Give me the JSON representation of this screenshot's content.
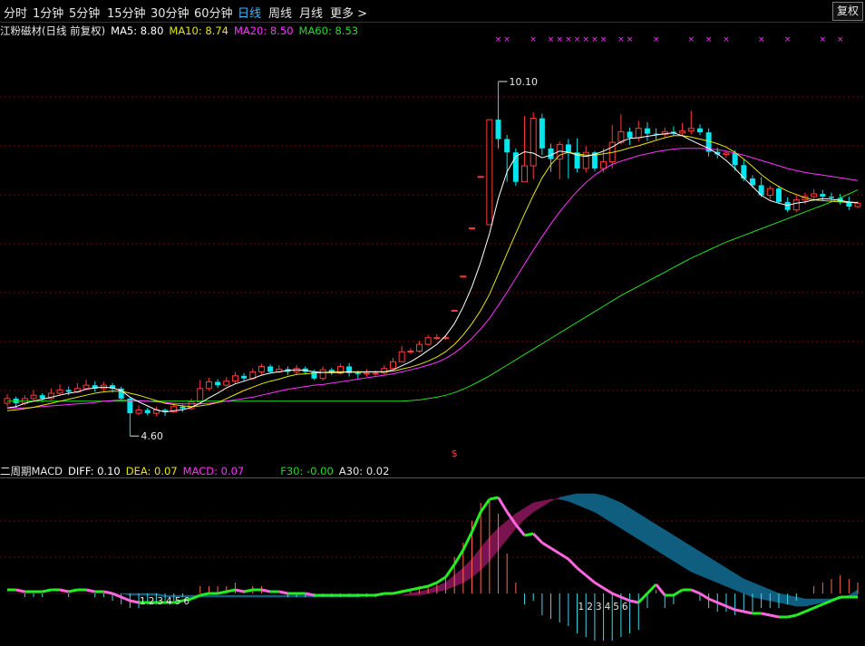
{
  "toolbar": {
    "tabs": [
      "分时",
      "1分钟",
      "5分钟",
      "15分钟",
      "30分钟",
      "60分钟",
      "日线",
      "周线",
      "月线",
      "更多 >"
    ],
    "active": "日线",
    "fq_label": "复权"
  },
  "colors": {
    "up": "#ff3b3b",
    "down": "#00e5ee",
    "ma5": "#ffffff",
    "ma10": "#e6e600",
    "ma20": "#ff33ff",
    "ma60": "#22dd22",
    "grid": "#7a0000",
    "text": "#e6e6e6"
  },
  "main_legend": {
    "title": "江粉磁材(日线 前复权)",
    "ma5": "MA5: 8.80",
    "ma10": "MA10: 8.74",
    "ma20": "MA20: 8.50",
    "ma60": "MA60: 8.53"
  },
  "macd_legend": {
    "title": "二周期MACD",
    "diff": "DIFF: 0.10",
    "dea": "DEA: 0.07",
    "macd": "MACD: 0.07",
    "f30": "F30: -0.00",
    "a30": "A30: 0.02"
  },
  "chart_data": {
    "type": "candlestick",
    "high_label": "10.10",
    "low_label": "4.60",
    "marker_symbol": "$",
    "count_labels_1": [
      "1",
      "2",
      "3",
      "4",
      "5",
      "6"
    ],
    "count_labels_2": [
      "1",
      "2",
      "3",
      "4",
      "5",
      "6"
    ],
    "candles": [
      [
        5.09,
        5.16,
        5.23,
        5.04
      ],
      [
        5.16,
        5.09,
        5.19,
        5.01
      ],
      [
        5.09,
        5.16,
        5.21,
        5.06
      ],
      [
        5.16,
        5.21,
        5.29,
        5.12
      ],
      [
        5.21,
        5.16,
        5.24,
        5.11
      ],
      [
        5.16,
        5.24,
        5.31,
        5.14
      ],
      [
        5.24,
        5.29,
        5.37,
        5.21
      ],
      [
        5.29,
        5.26,
        5.34,
        5.21
      ],
      [
        5.26,
        5.31,
        5.39,
        5.24
      ],
      [
        5.31,
        5.36,
        5.44,
        5.29
      ],
      [
        5.36,
        5.31,
        5.42,
        5.26
      ],
      [
        5.31,
        5.36,
        5.41,
        5.27
      ],
      [
        5.36,
        5.31,
        5.39,
        5.25
      ],
      [
        5.31,
        5.16,
        5.34,
        5.13
      ],
      [
        5.16,
        4.94,
        5.17,
        4.6
      ],
      [
        4.94,
        4.99,
        5.06,
        4.91
      ],
      [
        4.99,
        4.94,
        5.02,
        4.91
      ],
      [
        4.94,
        4.99,
        5.04,
        4.9
      ],
      [
        4.99,
        4.96,
        5.01,
        4.9
      ],
      [
        4.96,
        5.04,
        5.09,
        4.94
      ],
      [
        5.04,
        5.01,
        5.07,
        4.96
      ],
      [
        5.01,
        5.11,
        5.16,
        4.99
      ],
      [
        5.11,
        5.31,
        5.44,
        5.08
      ],
      [
        5.31,
        5.41,
        5.47,
        5.28
      ],
      [
        5.41,
        5.36,
        5.45,
        5.32
      ],
      [
        5.36,
        5.42,
        5.48,
        5.34
      ],
      [
        5.42,
        5.5,
        5.56,
        5.38
      ],
      [
        5.5,
        5.46,
        5.54,
        5.42
      ],
      [
        5.46,
        5.56,
        5.61,
        5.44
      ],
      [
        5.56,
        5.64,
        5.68,
        5.52
      ],
      [
        5.64,
        5.56,
        5.67,
        5.53
      ],
      [
        5.56,
        5.6,
        5.66,
        5.54
      ],
      [
        5.6,
        5.56,
        5.64,
        5.51
      ],
      [
        5.56,
        5.61,
        5.66,
        5.52
      ],
      [
        5.61,
        5.56,
        5.64,
        5.52
      ],
      [
        5.56,
        5.46,
        5.59,
        5.44
      ],
      [
        5.46,
        5.59,
        5.64,
        5.43
      ],
      [
        5.59,
        5.54,
        5.62,
        5.51
      ],
      [
        5.54,
        5.64,
        5.68,
        5.52
      ],
      [
        5.64,
        5.54,
        5.69,
        5.49
      ],
      [
        5.54,
        5.53,
        5.58,
        5.46
      ],
      [
        5.53,
        5.54,
        5.6,
        5.49
      ],
      [
        5.54,
        5.54,
        5.58,
        5.5
      ],
      [
        5.54,
        5.61,
        5.66,
        5.52
      ],
      [
        5.61,
        5.71,
        5.77,
        5.6
      ],
      [
        5.71,
        5.86,
        5.95,
        5.71
      ],
      [
        5.86,
        5.87,
        5.91,
        5.83
      ],
      [
        5.87,
        5.97,
        6.02,
        5.85
      ],
      [
        5.97,
        6.07,
        6.11,
        5.95
      ],
      [
        6.07,
        6.07,
        6.12,
        6.04
      ],
      [
        6.07,
        6.07,
        6.1,
        6.04
      ],
      [
        6.48,
        6.48,
        6.48,
        6.48
      ],
      [
        6.99,
        6.99,
        6.99,
        6.99
      ],
      [
        7.71,
        7.71,
        7.71,
        7.71
      ],
      [
        8.48,
        8.48,
        8.48,
        8.48
      ],
      [
        7.76,
        9.33,
        9.33,
        7.76
      ],
      [
        9.33,
        9.04,
        9.9,
        8.9
      ],
      [
        9.04,
        8.84,
        9.1,
        8.4
      ],
      [
        8.84,
        8.4,
        8.9,
        8.34
      ],
      [
        8.4,
        8.64,
        9.38,
        8.4
      ],
      [
        8.64,
        9.35,
        9.44,
        8.44
      ],
      [
        9.35,
        8.9,
        9.42,
        8.8
      ],
      [
        8.9,
        8.74,
        8.97,
        8.55
      ],
      [
        8.74,
        8.96,
        9.0,
        8.44
      ],
      [
        8.96,
        8.84,
        9.04,
        8.45
      ],
      [
        8.84,
        8.6,
        9.05,
        8.54
      ],
      [
        8.6,
        8.84,
        8.93,
        8.54
      ],
      [
        8.84,
        8.6,
        8.86,
        8.56
      ],
      [
        8.6,
        8.7,
        8.9,
        8.54
      ],
      [
        8.7,
        8.99,
        9.25,
        8.6
      ],
      [
        8.99,
        9.15,
        9.41,
        8.96
      ],
      [
        9.15,
        9.06,
        9.21,
        8.95
      ],
      [
        9.06,
        9.2,
        9.31,
        9.0
      ],
      [
        9.2,
        9.12,
        9.29,
        9.01
      ],
      [
        9.12,
        9.11,
        9.2,
        9.03
      ],
      [
        9.11,
        9.15,
        9.21,
        9.07
      ],
      [
        9.15,
        9.13,
        9.23,
        9.09
      ],
      [
        9.13,
        9.16,
        9.28,
        9.09
      ],
      [
        9.16,
        9.2,
        9.46,
        9.11
      ],
      [
        9.2,
        9.14,
        9.26,
        9.1
      ],
      [
        9.14,
        8.85,
        9.2,
        8.78
      ],
      [
        8.85,
        8.81,
        8.91,
        8.75
      ],
      [
        8.81,
        8.83,
        8.86,
        8.76
      ],
      [
        8.83,
        8.65,
        8.87,
        8.57
      ],
      [
        8.65,
        8.45,
        8.73,
        8.41
      ],
      [
        8.45,
        8.35,
        8.5,
        8.31
      ],
      [
        8.35,
        8.2,
        8.47,
        8.17
      ],
      [
        8.2,
        8.3,
        8.34,
        8.14
      ],
      [
        8.3,
        8.1,
        8.34,
        8.07
      ],
      [
        8.1,
        7.98,
        8.17,
        7.95
      ],
      [
        7.98,
        8.13,
        8.2,
        7.95
      ],
      [
        8.13,
        8.18,
        8.24,
        8.07
      ],
      [
        8.18,
        8.22,
        8.29,
        8.11
      ],
      [
        8.22,
        8.18,
        8.28,
        8.12
      ],
      [
        8.18,
        8.16,
        8.24,
        8.11
      ],
      [
        8.16,
        8.1,
        8.22,
        8.06
      ],
      [
        8.1,
        8.03,
        8.18,
        7.98
      ],
      [
        8.03,
        8.08,
        8.11,
        8.01
      ]
    ],
    "ma5": [
      5.02,
      5.04,
      5.09,
      5.12,
      5.15,
      5.18,
      5.21,
      5.24,
      5.26,
      5.3,
      5.32,
      5.33,
      5.32,
      5.28,
      5.18,
      5.11,
      5.05,
      4.99,
      4.96,
      4.98,
      4.99,
      5.03,
      5.09,
      5.17,
      5.24,
      5.32,
      5.38,
      5.42,
      5.46,
      5.51,
      5.54,
      5.56,
      5.58,
      5.59,
      5.58,
      5.56,
      5.55,
      5.55,
      5.55,
      5.56,
      5.55,
      5.56,
      5.56,
      5.56,
      5.59,
      5.65,
      5.71,
      5.79,
      5.88,
      5.97,
      6.1,
      6.28,
      6.53,
      6.83,
      7.2,
      7.63,
      8.15,
      8.55,
      8.78,
      8.85,
      8.83,
      8.76,
      8.8,
      8.86,
      8.84,
      8.8,
      8.78,
      8.81,
      8.86,
      8.92,
      9.0,
      9.05,
      9.06,
      9.08,
      9.1,
      9.12,
      9.13,
      9.09,
      9.02,
      8.96,
      8.9,
      8.82,
      8.72,
      8.6,
      8.46,
      8.33,
      8.2,
      8.12,
      8.08,
      8.05,
      8.08,
      8.1,
      8.13,
      8.15,
      8.14,
      8.12,
      8.1,
      8.09
    ],
    "ma10": [
      4.98,
      4.99,
      5.01,
      5.03,
      5.06,
      5.09,
      5.12,
      5.15,
      5.18,
      5.21,
      5.24,
      5.26,
      5.27,
      5.27,
      5.24,
      5.21,
      5.17,
      5.13,
      5.09,
      5.07,
      5.05,
      5.04,
      5.05,
      5.07,
      5.1,
      5.16,
      5.22,
      5.28,
      5.33,
      5.38,
      5.42,
      5.45,
      5.49,
      5.52,
      5.53,
      5.54,
      5.55,
      5.56,
      5.56,
      5.56,
      5.56,
      5.56,
      5.56,
      5.56,
      5.57,
      5.6,
      5.63,
      5.67,
      5.72,
      5.78,
      5.86,
      5.97,
      6.11,
      6.28,
      6.48,
      6.72,
      7.02,
      7.33,
      7.63,
      7.92,
      8.2,
      8.46,
      8.66,
      8.8,
      8.84,
      8.82,
      8.8,
      8.8,
      8.82,
      8.84,
      8.87,
      8.91,
      8.94,
      8.98,
      9.02,
      9.06,
      9.09,
      9.09,
      9.07,
      9.04,
      9.01,
      8.97,
      8.92,
      8.84,
      8.74,
      8.63,
      8.51,
      8.41,
      8.33,
      8.26,
      8.21,
      8.16,
      8.13,
      8.12,
      8.11,
      8.1,
      8.09,
      8.09
    ],
    "ma20": [
      5.02,
      5.02,
      5.02,
      5.03,
      5.04,
      5.05,
      5.06,
      5.07,
      5.08,
      5.09,
      5.1,
      5.12,
      5.13,
      5.14,
      5.13,
      5.13,
      5.12,
      5.11,
      5.1,
      5.09,
      5.08,
      5.08,
      5.08,
      5.09,
      5.1,
      5.12,
      5.14,
      5.16,
      5.18,
      5.21,
      5.24,
      5.27,
      5.3,
      5.32,
      5.34,
      5.36,
      5.37,
      5.39,
      5.41,
      5.43,
      5.45,
      5.47,
      5.49,
      5.51,
      5.53,
      5.56,
      5.59,
      5.62,
      5.66,
      5.7,
      5.76,
      5.84,
      5.94,
      6.06,
      6.2,
      6.36,
      6.55,
      6.75,
      6.96,
      7.17,
      7.38,
      7.58,
      7.77,
      7.95,
      8.11,
      8.26,
      8.39,
      8.5,
      8.59,
      8.66,
      8.71,
      8.75,
      8.79,
      8.82,
      8.85,
      8.87,
      8.89,
      8.9,
      8.9,
      8.9,
      8.89,
      8.88,
      8.86,
      8.83,
      8.8,
      8.76,
      8.72,
      8.68,
      8.64,
      8.6,
      8.57,
      8.54,
      8.52,
      8.5,
      8.48,
      8.46,
      8.44,
      8.42
    ],
    "ma60": [
      5.12,
      5.12,
      5.12,
      5.12,
      5.12,
      5.12,
      5.12,
      5.12,
      5.12,
      5.12,
      5.12,
      5.12,
      5.12,
      5.12,
      5.12,
      5.12,
      5.12,
      5.12,
      5.12,
      5.12,
      5.12,
      5.12,
      5.12,
      5.12,
      5.12,
      5.12,
      5.12,
      5.12,
      5.12,
      5.12,
      5.12,
      5.12,
      5.12,
      5.12,
      5.12,
      5.12,
      5.12,
      5.12,
      5.12,
      5.12,
      5.12,
      5.12,
      5.12,
      5.12,
      5.12,
      5.12,
      5.13,
      5.14,
      5.16,
      5.18,
      5.21,
      5.25,
      5.3,
      5.36,
      5.43,
      5.5,
      5.58,
      5.66,
      5.74,
      5.82,
      5.9,
      5.98,
      6.06,
      6.14,
      6.22,
      6.3,
      6.38,
      6.46,
      6.54,
      6.62,
      6.7,
      6.77,
      6.84,
      6.91,
      6.98,
      7.05,
      7.12,
      7.19,
      7.26,
      7.32,
      7.38,
      7.44,
      7.5,
      7.55,
      7.6,
      7.65,
      7.7,
      7.75,
      7.8,
      7.85,
      7.9,
      7.95,
      8.0,
      8.05,
      8.1,
      8.16,
      8.22,
      8.28
    ],
    "diff": [
      0.02,
      0.02,
      0.01,
      0.01,
      0.01,
      0.02,
      0.02,
      0.01,
      0.02,
      0.02,
      0.01,
      0.01,
      0.0,
      -0.02,
      -0.04,
      -0.05,
      -0.05,
      -0.05,
      -0.05,
      -0.05,
      -0.04,
      -0.03,
      -0.01,
      0.0,
      0.0,
      0.01,
      0.02,
      0.01,
      0.02,
      0.02,
      0.01,
      0.01,
      0.0,
      0.0,
      0.0,
      -0.01,
      -0.01,
      -0.01,
      -0.01,
      -0.01,
      -0.01,
      -0.01,
      -0.01,
      0.0,
      0.0,
      0.01,
      0.02,
      0.03,
      0.04,
      0.06,
      0.09,
      0.16,
      0.24,
      0.34,
      0.45,
      0.52,
      0.53,
      0.45,
      0.38,
      0.32,
      0.33,
      0.28,
      0.25,
      0.22,
      0.19,
      0.14,
      0.1,
      0.06,
      0.03,
      0.0,
      -0.02,
      -0.04,
      -0.05,
      0.0,
      0.05,
      -0.01,
      -0.01,
      0.02,
      0.02,
      0.0,
      -0.03,
      -0.05,
      -0.07,
      -0.09,
      -0.1,
      -0.11,
      -0.11,
      -0.12,
      -0.13,
      -0.13,
      -0.12,
      -0.1,
      -0.08,
      -0.06,
      -0.04,
      -0.02,
      -0.02,
      -0.02
    ],
    "dea": [
      0.02,
      0.02,
      0.02,
      0.02,
      0.02,
      0.02,
      0.02,
      0.02,
      0.02,
      0.02,
      0.02,
      0.02,
      0.02,
      0.01,
      0.0,
      -0.01,
      -0.02,
      -0.02,
      -0.03,
      -0.03,
      -0.03,
      -0.03,
      -0.03,
      -0.02,
      -0.02,
      -0.01,
      -0.01,
      0.0,
      0.0,
      0.0,
      0.01,
      0.01,
      0.01,
      0.01,
      0.01,
      0.0,
      0.0,
      0.0,
      0.0,
      0.0,
      0.0,
      0.0,
      0.0,
      0.0,
      0.0,
      0.0,
      0.01,
      0.01,
      0.02,
      0.03,
      0.04,
      0.06,
      0.1,
      0.14,
      0.2,
      0.26,
      0.31,
      0.34,
      0.35,
      0.35,
      0.35,
      0.34,
      0.32,
      0.3,
      0.28,
      0.25,
      0.22,
      0.19,
      0.16,
      0.13,
      0.1,
      0.07,
      0.05,
      0.04,
      0.04,
      0.03,
      0.02,
      0.02,
      0.02,
      0.02,
      0.01,
      0.0,
      -0.02,
      -0.03,
      -0.05,
      -0.06,
      -0.07,
      -0.08,
      -0.09,
      -0.1,
      -0.1,
      -0.1,
      -0.1,
      -0.09,
      -0.08,
      -0.07,
      -0.06,
      -0.05
    ],
    "f30": [
      0.0,
      0.0,
      0.0,
      0.0,
      0.0,
      0.0,
      0.0,
      0.0,
      0.0,
      0.0,
      0.0,
      0.0,
      0.0,
      0.0,
      -0.01,
      -0.01,
      -0.01,
      -0.01,
      -0.02,
      -0.02,
      -0.02,
      -0.02,
      -0.02,
      -0.02,
      -0.02,
      -0.02,
      -0.02,
      -0.02,
      -0.02,
      -0.02,
      -0.02,
      -0.02,
      -0.02,
      -0.02,
      -0.02,
      -0.02,
      -0.02,
      -0.02,
      -0.02,
      -0.02,
      -0.02,
      -0.01,
      -0.01,
      -0.01,
      -0.01,
      -0.01,
      0.0,
      0.01,
      0.02,
      0.04,
      0.06,
      0.1,
      0.14,
      0.19,
      0.25,
      0.31,
      0.36,
      0.4,
      0.44,
      0.47,
      0.5,
      0.51,
      0.52,
      0.52,
      0.51,
      0.49,
      0.47,
      0.45,
      0.42,
      0.39,
      0.36,
      0.33,
      0.3,
      0.27,
      0.24,
      0.21,
      0.18,
      0.15,
      0.12,
      0.1,
      0.08,
      0.06,
      0.04,
      0.02,
      0.0,
      -0.02,
      -0.03,
      -0.04,
      -0.05,
      -0.06,
      -0.07,
      -0.07,
      -0.06,
      -0.05,
      -0.04,
      -0.03,
      -0.02,
      -0.01
    ],
    "a30": [
      0.0,
      0.0,
      0.0,
      0.0,
      0.0,
      0.0,
      0.0,
      0.0,
      0.0,
      0.0,
      0.0,
      0.0,
      0.0,
      0.0,
      0.0,
      0.0,
      0.0,
      0.0,
      -0.01,
      -0.01,
      -0.01,
      -0.01,
      -0.01,
      -0.01,
      -0.01,
      -0.01,
      -0.01,
      -0.01,
      -0.01,
      -0.01,
      -0.01,
      -0.01,
      -0.01,
      -0.01,
      -0.01,
      -0.01,
      -0.01,
      -0.01,
      -0.01,
      -0.01,
      -0.01,
      -0.01,
      -0.01,
      -0.01,
      -0.01,
      -0.01,
      -0.01,
      -0.01,
      0.0,
      0.01,
      0.02,
      0.04,
      0.06,
      0.09,
      0.13,
      0.18,
      0.24,
      0.3,
      0.36,
      0.41,
      0.45,
      0.48,
      0.51,
      0.53,
      0.54,
      0.55,
      0.55,
      0.55,
      0.54,
      0.52,
      0.5,
      0.47,
      0.44,
      0.41,
      0.38,
      0.35,
      0.32,
      0.29,
      0.26,
      0.23,
      0.2,
      0.17,
      0.14,
      0.11,
      0.08,
      0.06,
      0.04,
      0.02,
      0.0,
      -0.01,
      -0.02,
      -0.03,
      -0.03,
      -0.03,
      -0.03,
      -0.02,
      -0.01,
      0.02
    ]
  }
}
